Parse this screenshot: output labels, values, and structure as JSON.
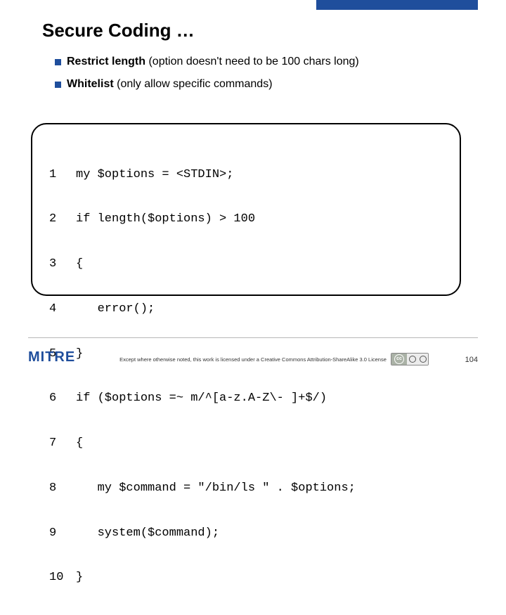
{
  "title": "Secure Coding …",
  "bullets": [
    {
      "strong": "Restrict length",
      "rest": "  (option doesn't need to be 100 chars long)"
    },
    {
      "strong": "Whitelist",
      "rest": " (only allow specific commands)"
    }
  ],
  "code": [
    {
      "n": "1",
      "t": "my $options = <STDIN>;"
    },
    {
      "n": "2",
      "t": "if length($options) > 100"
    },
    {
      "n": "3",
      "t": "{"
    },
    {
      "n": "4",
      "t": "   error();"
    },
    {
      "n": "5",
      "t": "}"
    },
    {
      "n": "6",
      "t": "if ($options =~ m/^[a-z.A-Z\\- ]+$/)"
    },
    {
      "n": "7",
      "t": "{"
    },
    {
      "n": "8",
      "t": "   my $command = \"/bin/ls \" . $options;"
    },
    {
      "n": "9",
      "t": "   system($command);"
    },
    {
      "n": "10",
      "t": "}"
    }
  ],
  "logo": "MITRE",
  "license_text": "Except where otherwise noted, this work is licensed under a Creative Commons Attribution-ShareAlike 3.0 License",
  "cc_label": "cc",
  "page_number": "104"
}
